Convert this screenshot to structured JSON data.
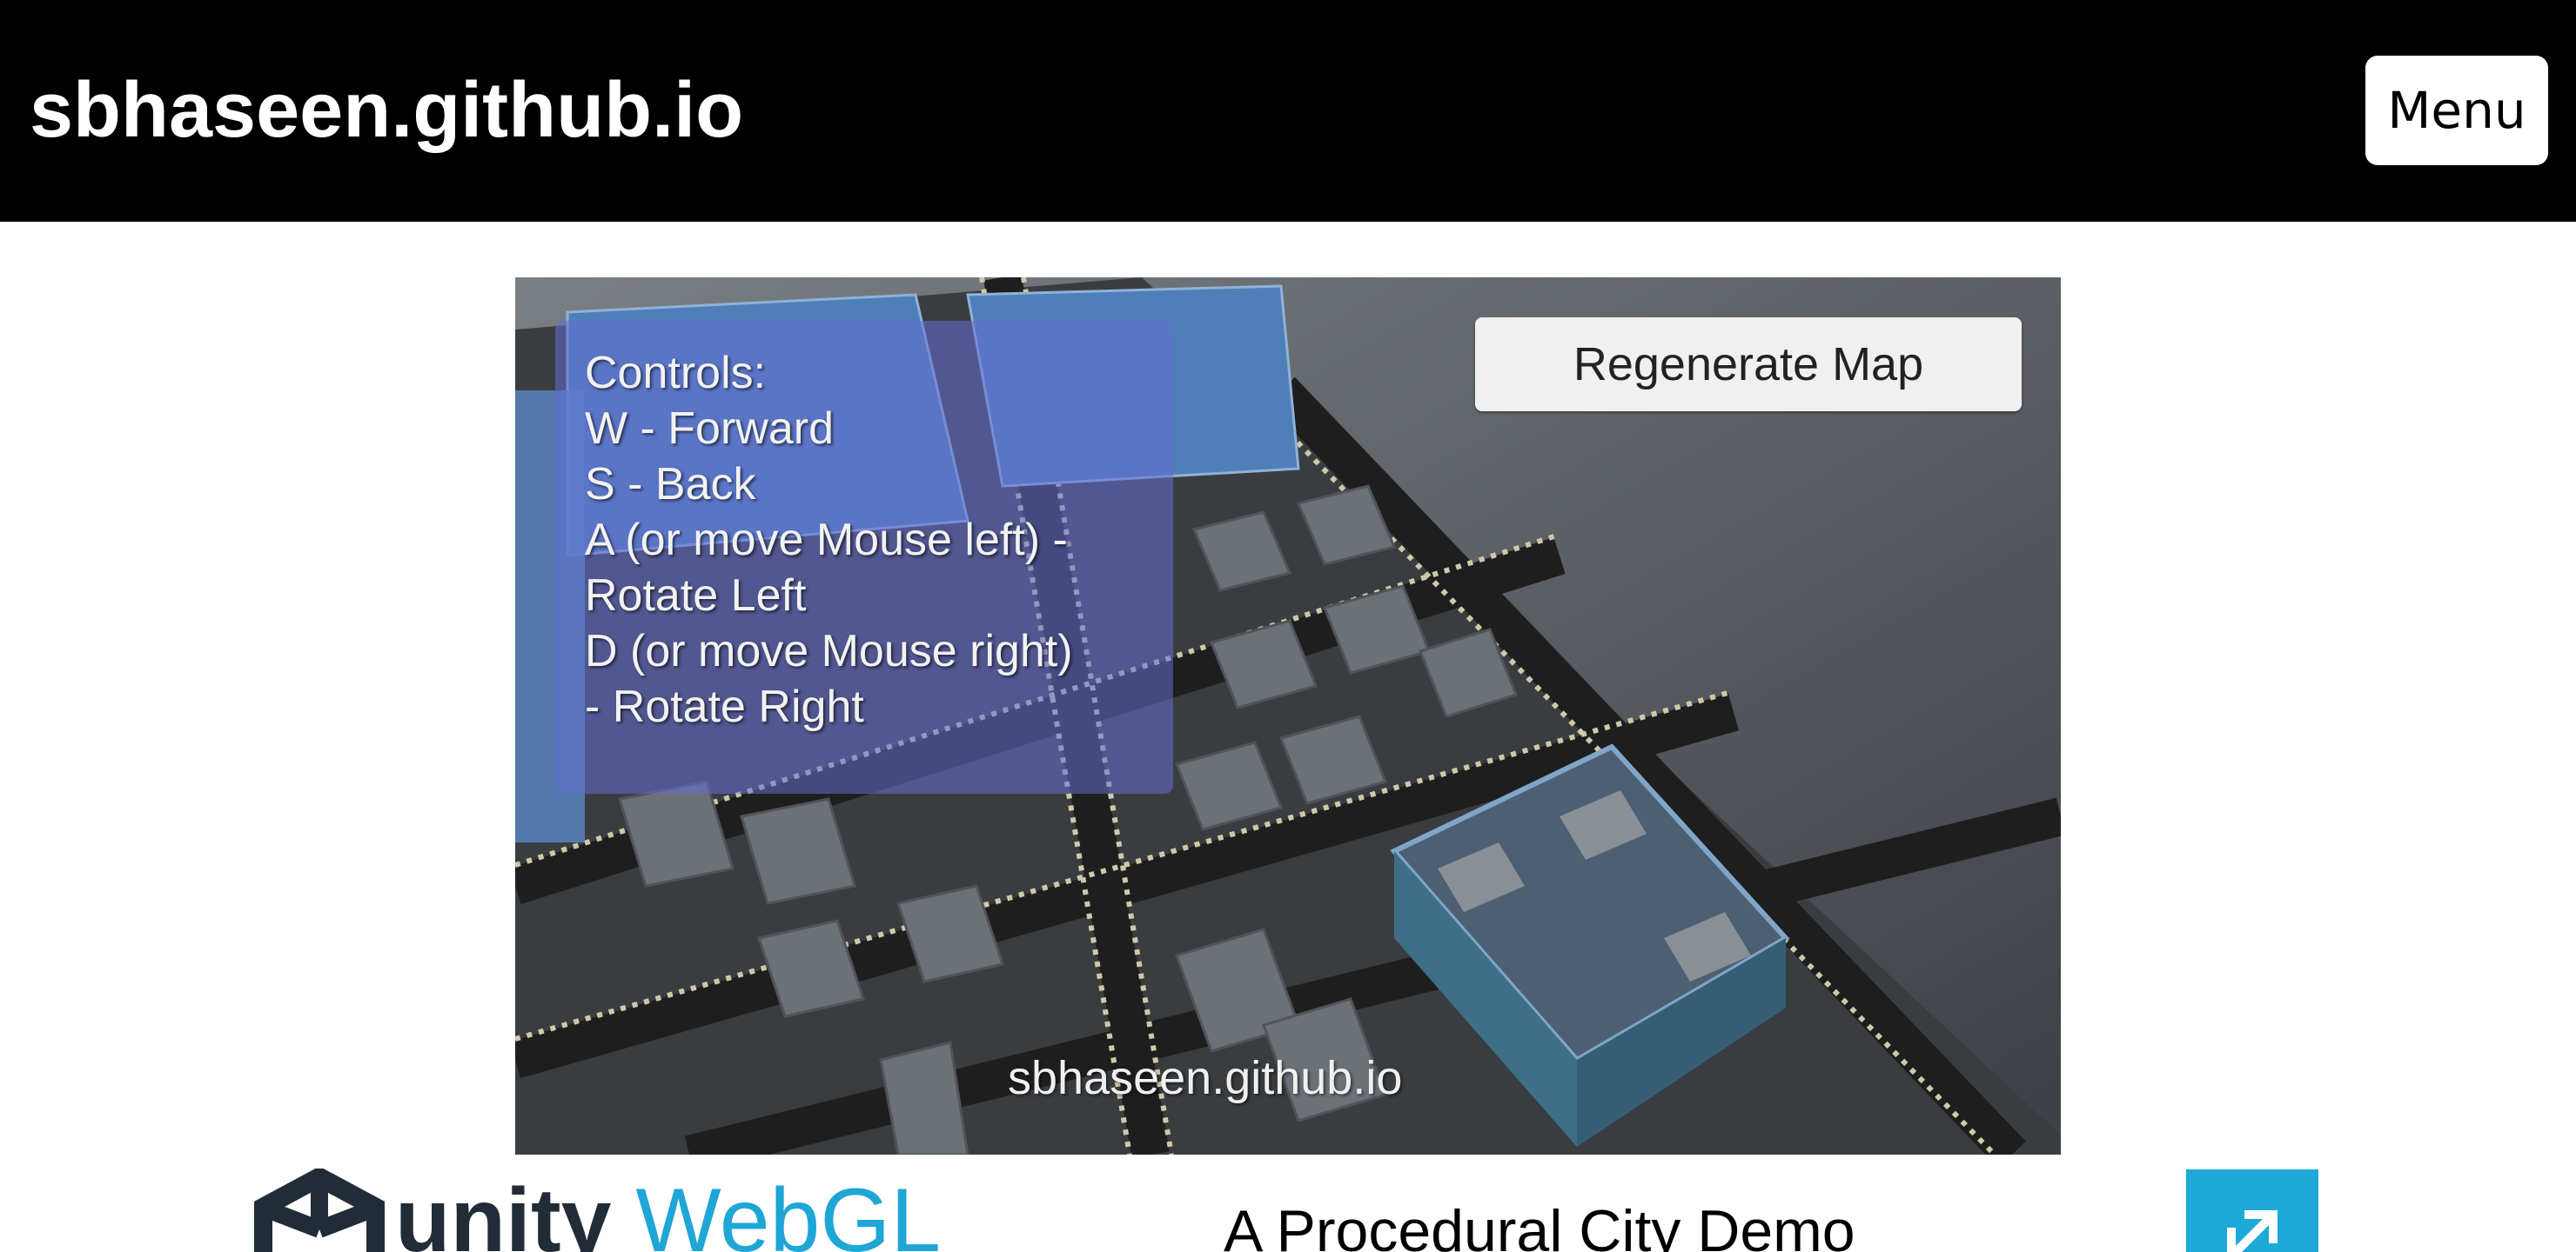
{
  "header": {
    "site_title": "sbhaseen.github.io",
    "menu_label": "Menu"
  },
  "game": {
    "controls_lines": [
      "Controls:",
      "W - Forward",
      "S - Back",
      "A (or move Mouse left) -",
      "Rotate Left",
      "D (or move Mouse right)",
      "- Rotate Right"
    ],
    "regenerate_label": "Regenerate Map",
    "watermark": "sbhaseen.github.io"
  },
  "footer": {
    "unity_word": "unity",
    "webgl_word": "WebGL",
    "demo_title": "A Procedural City Demo",
    "fullscreen_icon": "fullscreen-expand-icon"
  },
  "colors": {
    "header_bg": "#000000",
    "unity_dark": "#222c37",
    "webgl_blue": "#1ea6d6",
    "fullscreen_bg": "#1ea9d8"
  }
}
